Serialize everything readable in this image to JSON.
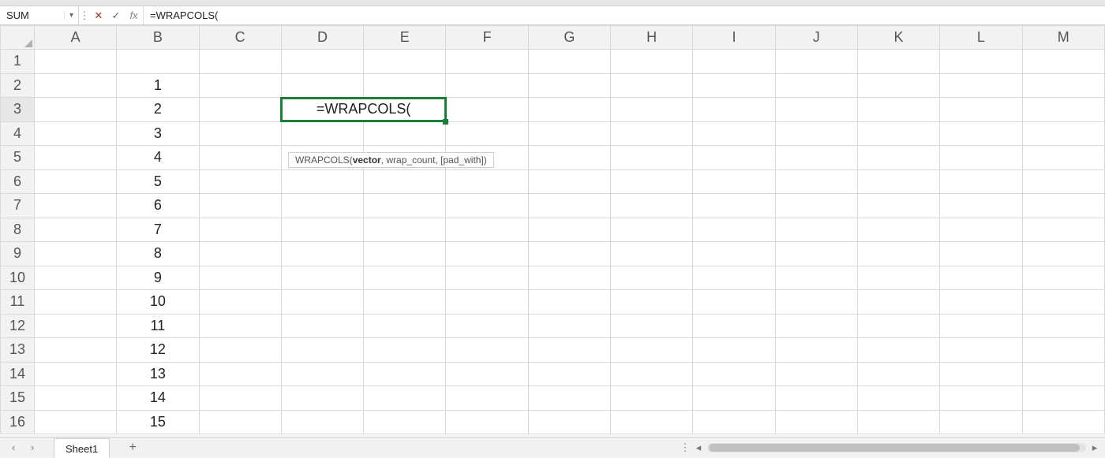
{
  "name_box": {
    "value": "SUM"
  },
  "formula_bar": {
    "cancel_glyph": "✕",
    "enter_glyph": "✓",
    "fx_label": "fx",
    "formula": "=WRAPCOLS("
  },
  "columns": [
    "A",
    "B",
    "C",
    "D",
    "E",
    "F",
    "G",
    "H",
    "I",
    "J",
    "K",
    "L",
    "M"
  ],
  "rows": [
    {
      "n": "1"
    },
    {
      "n": "2",
      "B": "1"
    },
    {
      "n": "3",
      "B": "2",
      "D_edit": "=WRAPCOLS("
    },
    {
      "n": "4",
      "B": "3"
    },
    {
      "n": "5",
      "B": "4"
    },
    {
      "n": "6",
      "B": "5"
    },
    {
      "n": "7",
      "B": "6"
    },
    {
      "n": "8",
      "B": "7"
    },
    {
      "n": "9",
      "B": "8"
    },
    {
      "n": "10",
      "B": "9"
    },
    {
      "n": "11",
      "B": "10"
    },
    {
      "n": "12",
      "B": "11"
    },
    {
      "n": "13",
      "B": "12"
    },
    {
      "n": "14",
      "B": "13"
    },
    {
      "n": "15",
      "B": "14"
    },
    {
      "n": "16",
      "B": "15"
    }
  ],
  "tooltip": {
    "fname": "WRAPCOLS(",
    "arg_bold": "vector",
    "rest": ", wrap_count, [pad_with])"
  },
  "tabs": {
    "active": "Sheet1"
  }
}
